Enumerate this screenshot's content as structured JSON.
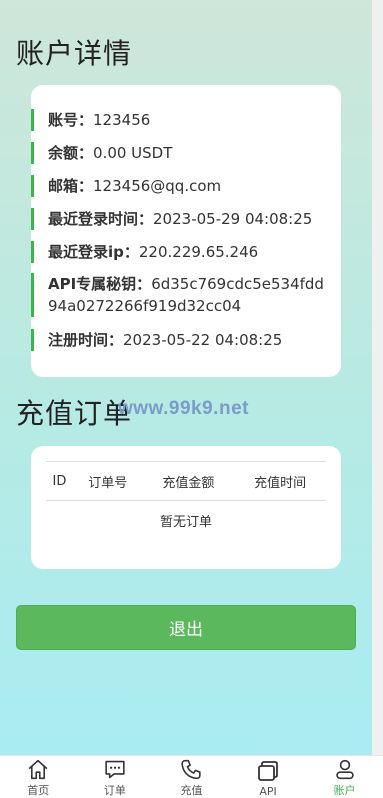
{
  "account_section": {
    "title": "账户详情",
    "rows": [
      {
        "key": "账号：",
        "value": "123456"
      },
      {
        "key": "余额：",
        "value": "0.00 USDT"
      },
      {
        "key": "邮箱：",
        "value": "123456@qq.com"
      },
      {
        "key": "最近登录时间：",
        "value": "2023-05-29 04:08:25"
      },
      {
        "key": "最近登录ip：",
        "value": "220.229.65.246"
      },
      {
        "key": "API专属秘钥：",
        "value": "6d35c769cdc5e534fdd94a0272266f919d32cc04"
      },
      {
        "key": "注册时间：",
        "value": "2023-05-22 04:08:25"
      }
    ]
  },
  "watermark": "www.99k9.net",
  "orders_section": {
    "title": "充值订单",
    "columns": [
      "ID",
      "订单号",
      "充值金额",
      "充值时间"
    ],
    "empty_text": "暂无订单"
  },
  "logout_label": "退出",
  "tabbar": {
    "items": [
      {
        "label": "首页",
        "icon": "home-icon"
      },
      {
        "label": "订单",
        "icon": "chat-icon"
      },
      {
        "label": "充值",
        "icon": "phone-icon"
      },
      {
        "label": "API",
        "icon": "cards-icon"
      },
      {
        "label": "账户",
        "icon": "user-icon"
      }
    ],
    "active_color": "#3bb54a",
    "active_index": 4
  },
  "colors": {
    "accent": "#3bb54a",
    "button": "#5cb85c"
  }
}
